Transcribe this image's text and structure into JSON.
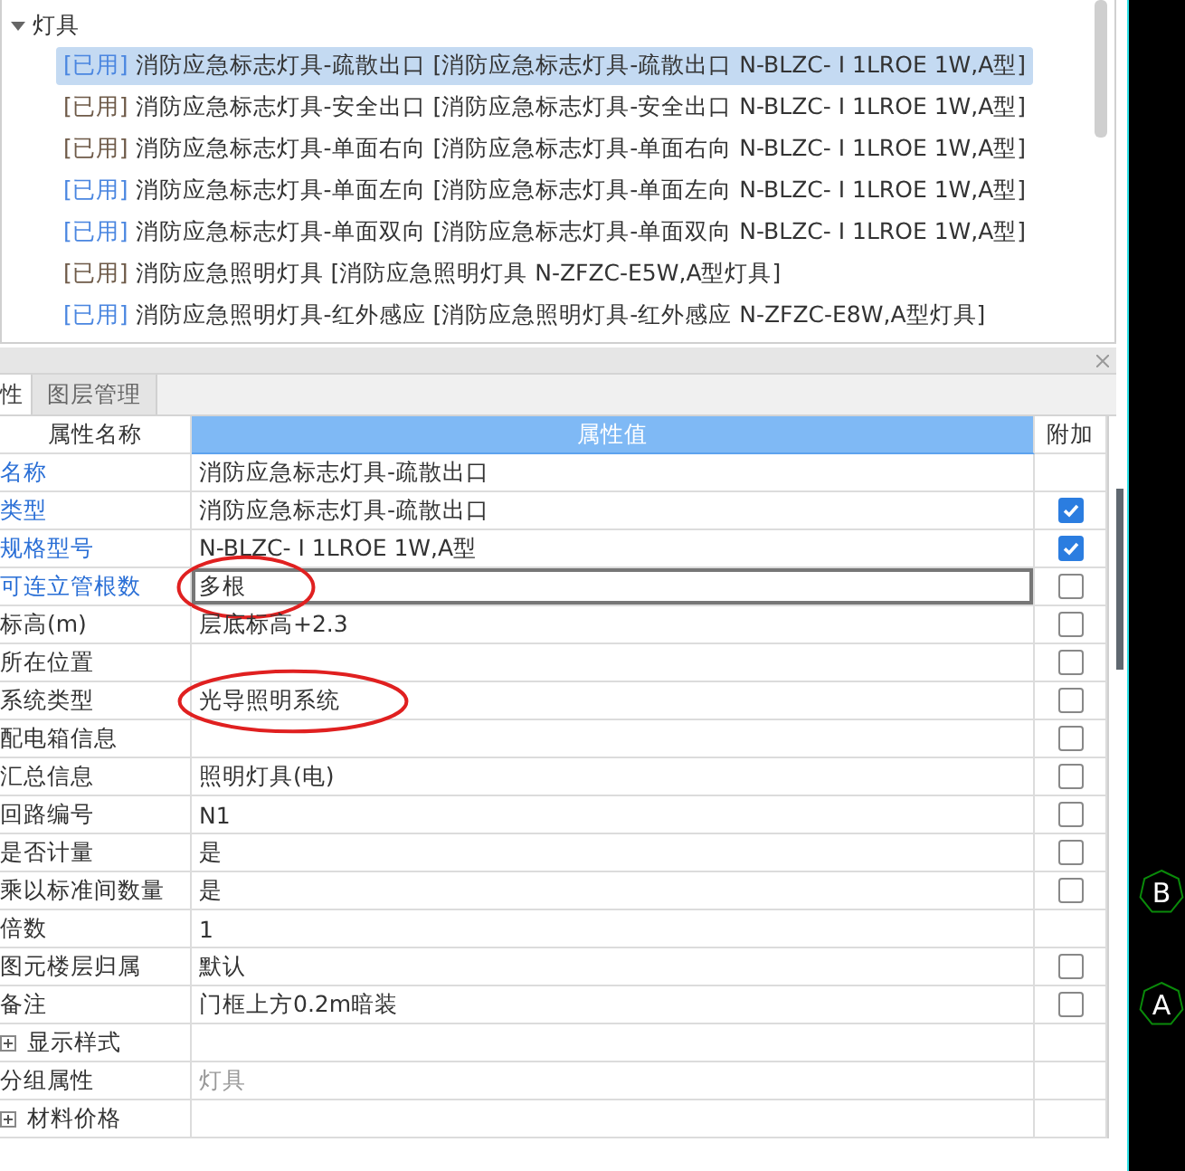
{
  "tree": {
    "group": {
      "label": "灯具",
      "expanded": true
    },
    "items": [
      {
        "tag": "[已用]",
        "color": "#4a86e0",
        "text": "消防应急标志灯具-疏散出口 [消防应急标志灯具-疏散出口 N-BLZC- Ⅰ 1LROE 1W,A型]",
        "selected": true
      },
      {
        "tag": "[已用]",
        "color": "#6e5a48",
        "text": "消防应急标志灯具-安全出口 [消防应急标志灯具-安全出口 N-BLZC- Ⅰ 1LROE 1W,A型]",
        "selected": false
      },
      {
        "tag": "[已用]",
        "color": "#6e5a48",
        "text": "消防应急标志灯具-单面右向 [消防应急标志灯具-单面右向 N-BLZC- Ⅰ 1LROE 1W,A型]",
        "selected": false
      },
      {
        "tag": "[已用]",
        "color": "#4a86e0",
        "text": "消防应急标志灯具-单面左向 [消防应急标志灯具-单面左向 N-BLZC- Ⅰ 1LROE 1W,A型]",
        "selected": false
      },
      {
        "tag": "[已用]",
        "color": "#4a86e0",
        "text": "消防应急标志灯具-单面双向 [消防应急标志灯具-单面双向 N-BLZC- Ⅰ 1LROE 1W,A型]",
        "selected": false
      },
      {
        "tag": "[已用]",
        "color": "#6e5a48",
        "text": "消防应急照明灯具 [消防应急照明灯具 N-ZFZC-E5W,A型灯具]",
        "selected": false
      },
      {
        "tag": "[已用]",
        "color": "#4a86e0",
        "text": "消防应急照明灯具-红外感应 [消防应急照明灯具-红外感应 N-ZFZC-E8W,A型灯具]",
        "selected": false
      }
    ]
  },
  "panel": {
    "tabs": [
      {
        "label": "性",
        "selected": true
      },
      {
        "label": "图层管理",
        "selected": false
      }
    ],
    "columns": [
      "属性名称",
      "属性值",
      "附加"
    ],
    "rows": [
      {
        "kind": "field",
        "name": "名称",
        "value": "消防应急标志灯具-疏散出口",
        "highlighted": true,
        "editing": false,
        "muted": false,
        "circled": false
      },
      {
        "kind": "field",
        "name": "类型",
        "value": "消防应急标志灯具-疏散出口",
        "highlighted": true,
        "editing": false,
        "muted": false,
        "circled": false,
        "checked": true
      },
      {
        "kind": "field",
        "name": "规格型号",
        "value": "N-BLZC- Ⅰ 1LROE 1W,A型",
        "highlighted": true,
        "editing": false,
        "muted": false,
        "circled": false,
        "checked": true
      },
      {
        "kind": "field",
        "name": "可连立管根数",
        "value": "多根",
        "highlighted": true,
        "editing": true,
        "muted": false,
        "circled": true,
        "checked": false
      },
      {
        "kind": "field",
        "name": "标高(m)",
        "value": "层底标高+2.3",
        "highlighted": false,
        "editing": false,
        "muted": false,
        "circled": false,
        "checked": false
      },
      {
        "kind": "field",
        "name": "所在位置",
        "highlighted": false,
        "editing": false,
        "circled": false,
        "checked": false
      },
      {
        "kind": "field",
        "name": "系统类型",
        "value": "光导照明系统",
        "highlighted": false,
        "editing": false,
        "muted": false,
        "circled": true,
        "checked": false
      },
      {
        "kind": "field",
        "name": "配电箱信息",
        "highlighted": false,
        "editing": false,
        "circled": false,
        "checked": false
      },
      {
        "kind": "field",
        "name": "汇总信息",
        "value": "照明灯具(电)",
        "highlighted": false,
        "editing": false,
        "muted": false,
        "circled": false,
        "checked": false
      },
      {
        "kind": "field",
        "name": "回路编号",
        "value": "N1",
        "highlighted": false,
        "editing": false,
        "muted": false,
        "circled": false,
        "checked": false
      },
      {
        "kind": "field",
        "name": "是否计量",
        "value": "是",
        "highlighted": false,
        "editing": false,
        "muted": false,
        "circled": false,
        "checked": false
      },
      {
        "kind": "field",
        "name": "乘以标准间数量",
        "value": "是",
        "highlighted": false,
        "editing": false,
        "muted": false,
        "circled": false,
        "checked": false
      },
      {
        "kind": "field",
        "name": "倍数",
        "value": "1",
        "highlighted": false,
        "editing": false,
        "muted": false,
        "circled": false
      },
      {
        "kind": "field",
        "name": "图元楼层归属",
        "value": "默认",
        "highlighted": false,
        "editing": false,
        "muted": false,
        "circled": false,
        "checked": false
      },
      {
        "kind": "field",
        "name": "备注",
        "value": "门框上方0.2m暗装",
        "highlighted": false,
        "editing": false,
        "muted": false,
        "circled": false,
        "checked": false
      },
      {
        "kind": "group",
        "name": "显示样式",
        "expanded": false
      },
      {
        "kind": "field",
        "name": "分组属性",
        "value": "灯具",
        "highlighted": false,
        "editing": false,
        "muted": true,
        "circled": false
      },
      {
        "kind": "group",
        "name": "材料价格",
        "expanded": false
      }
    ]
  },
  "canvas": {
    "axis_labels": [
      "B",
      "A"
    ]
  }
}
